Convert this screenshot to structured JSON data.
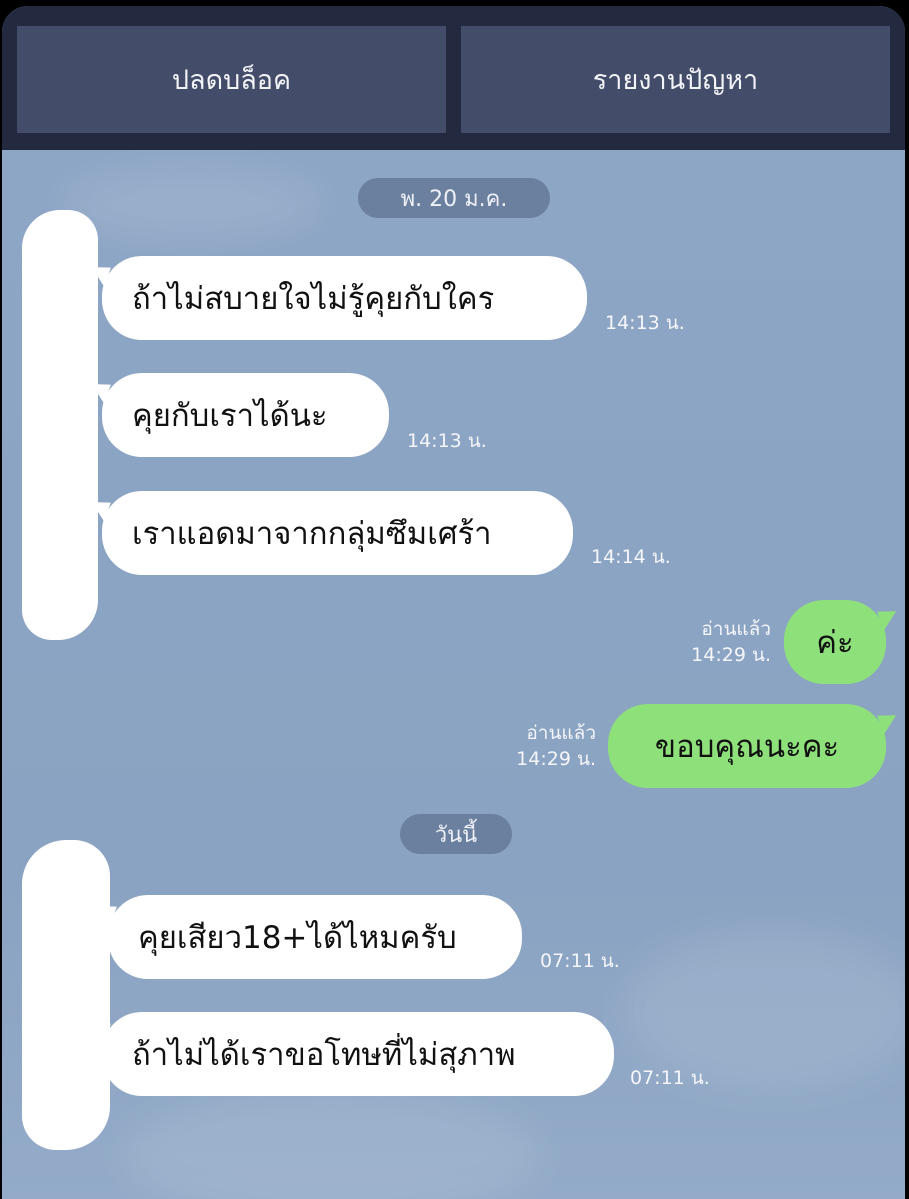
{
  "header": {
    "unblock_label": "ปลดบล็อค",
    "report_label": "รายงานปัญหา"
  },
  "dates": {
    "first": "พ. 20 ม.ค.",
    "today": "วันนี้"
  },
  "messages": [
    {
      "text": "ถ้าไม่สบายใจไม่รู้คุยกับใคร",
      "time": "14:13 น."
    },
    {
      "text": "คุยกับเราได้นะ",
      "time": "14:13 น."
    },
    {
      "text": "เราแอดมาจากกลุ่มซึมเศร้า",
      "time": "14:14 น."
    },
    {
      "text": "ค่ะ",
      "read": "อ่านแล้ว",
      "time": "14:29 น."
    },
    {
      "text": "ขอบคุณนะคะ",
      "read": "อ่านแล้ว",
      "time": "14:29 น."
    },
    {
      "text": "คุยเสียว18+ได้ไหมครับ",
      "time": "07:11 น."
    },
    {
      "text": "ถ้าไม่ได้เราขอโทษที่ไม่สุภาพ",
      "time": "07:11 น."
    }
  ],
  "colors": {
    "topbar": "#232a3f",
    "topbutton": "#434d69",
    "chat_background": "#8ea6c6",
    "incoming_bubble": "#ffffff",
    "outgoing_bubble": "#8ee07b"
  }
}
